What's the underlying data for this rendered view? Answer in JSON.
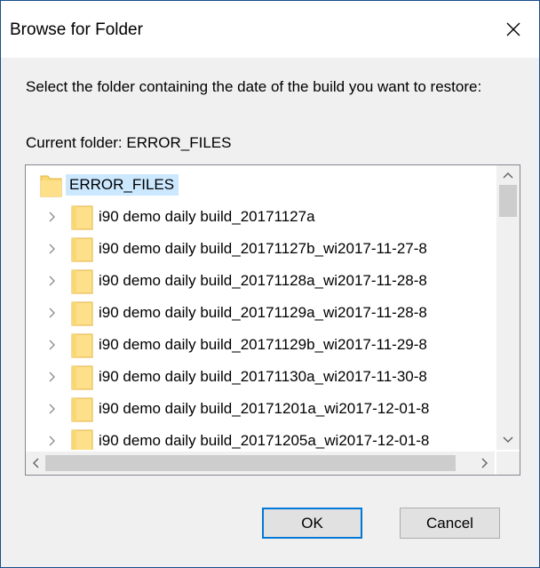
{
  "window": {
    "title": "Browse for Folder",
    "close_icon": "close-icon"
  },
  "instruction": "Select the folder containing the date of the build you want to restore:",
  "current_folder": "Current folder:  ERROR_FILES",
  "tree": {
    "root": {
      "label": "ERROR_FILES",
      "selected": true,
      "icon": "folder-icon"
    },
    "children": [
      {
        "label": "i90 demo daily build_20171127a",
        "icon": "folder-icon",
        "expander": "chevron-right-icon"
      },
      {
        "label": "i90 demo daily build_20171127b_wi2017-11-27-8",
        "icon": "folder-icon",
        "expander": "chevron-right-icon"
      },
      {
        "label": "i90 demo daily build_20171128a_wi2017-11-28-8",
        "icon": "folder-icon",
        "expander": "chevron-right-icon"
      },
      {
        "label": "i90 demo daily build_20171129a_wi2017-11-28-8",
        "icon": "folder-icon",
        "expander": "chevron-right-icon"
      },
      {
        "label": "i90 demo daily build_20171129b_wi2017-11-29-8",
        "icon": "folder-icon",
        "expander": "chevron-right-icon"
      },
      {
        "label": "i90 demo daily build_20171130a_wi2017-11-30-8",
        "icon": "folder-icon",
        "expander": "chevron-right-icon"
      },
      {
        "label": "i90 demo daily build_20171201a_wi2017-12-01-8",
        "icon": "folder-icon",
        "expander": "chevron-right-icon"
      },
      {
        "label": "i90 demo daily build_20171205a_wi2017-12-01-8",
        "icon": "folder-icon",
        "expander": "chevron-right-icon"
      }
    ]
  },
  "buttons": {
    "ok": "OK",
    "cancel": "Cancel"
  },
  "colors": {
    "accent": "#0078d7",
    "selection": "#cce8ff",
    "folder": "#ffd966"
  }
}
